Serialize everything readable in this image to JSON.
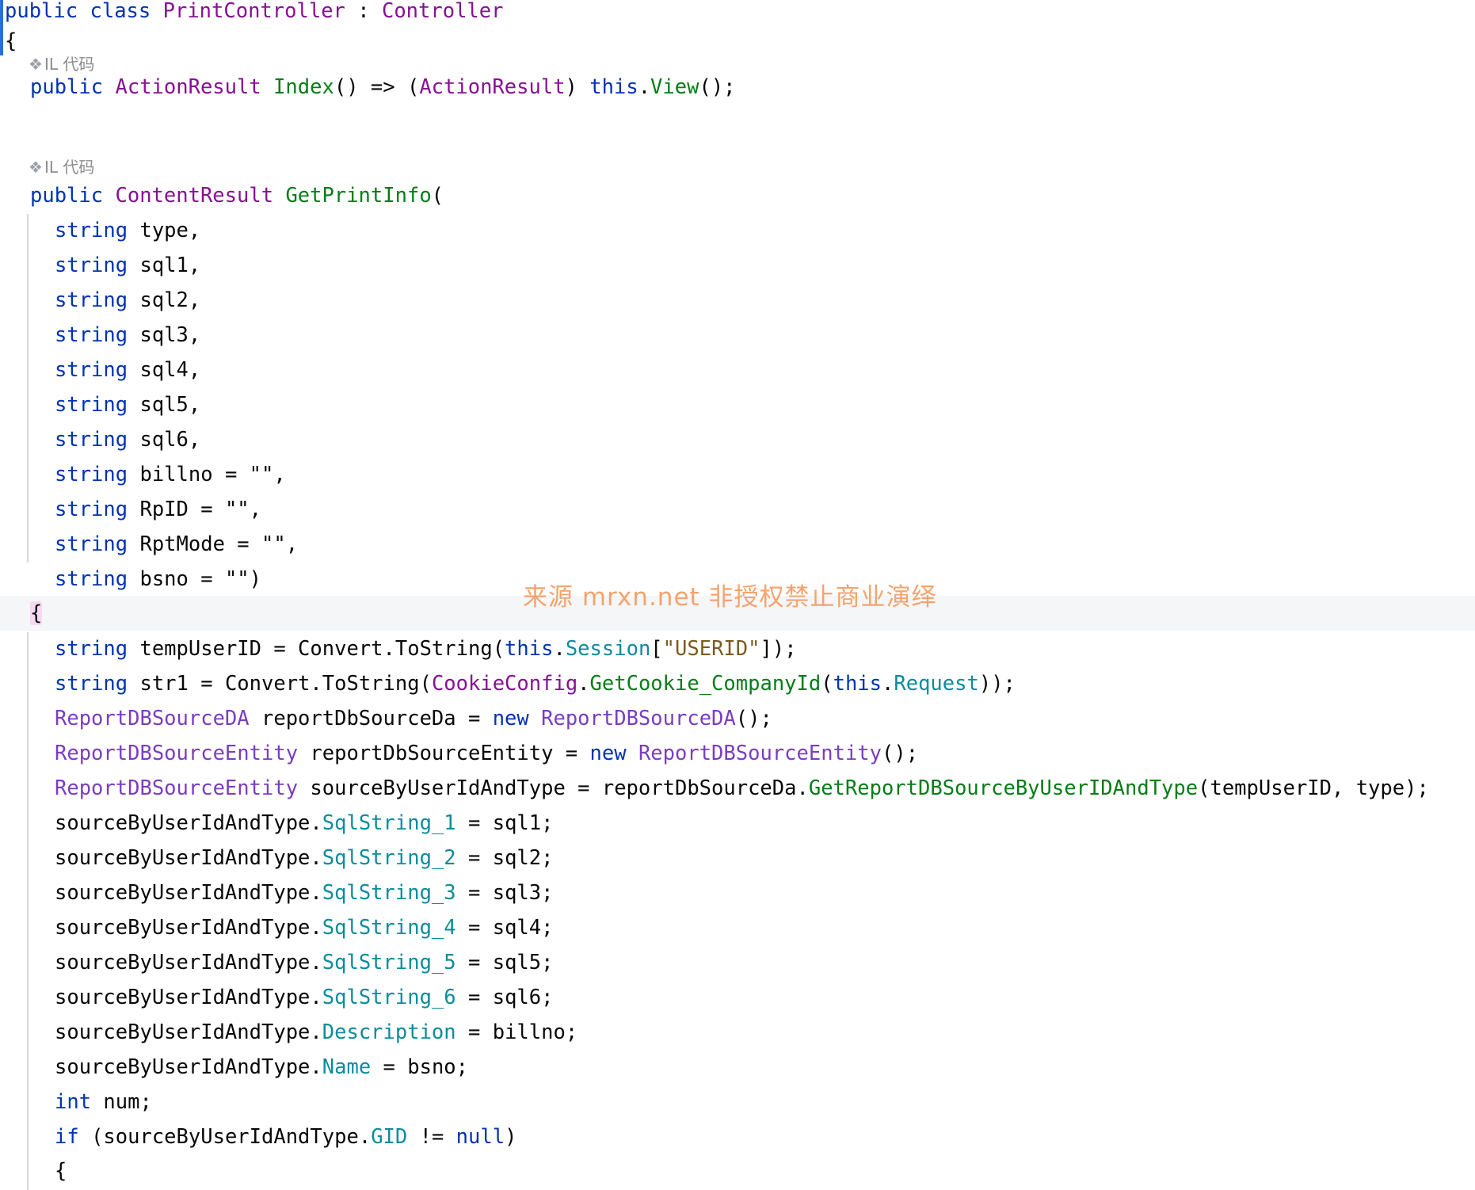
{
  "code": {
    "class_decl": {
      "kw_public": "public",
      "kw_class": "class",
      "class_name": "PrintController",
      "colon": " : ",
      "base": "Controller"
    },
    "open_brace": "{",
    "il_hint_1": "IL 代码",
    "index_line": {
      "kw_public": "public",
      "return_type": "ActionResult",
      "method": "Index",
      "rest1": "() => (",
      "cast_type": "ActionResult",
      "rest2": ") ",
      "kw_this": "this",
      "dot": ".",
      "call": "View",
      "rest3": "();"
    },
    "il_hint_2": "IL 代码",
    "getprint_line": {
      "kw_public": "public",
      "return_type": "ContentResult",
      "method": "GetPrintInfo",
      "paren": "("
    },
    "params": [
      {
        "kw": "string",
        "rest": " type,"
      },
      {
        "kw": "string",
        "rest": " sql1,"
      },
      {
        "kw": "string",
        "rest": " sql2,"
      },
      {
        "kw": "string",
        "rest": " sql3,"
      },
      {
        "kw": "string",
        "rest": " sql4,"
      },
      {
        "kw": "string",
        "rest": " sql5,"
      },
      {
        "kw": "string",
        "rest": " sql6,"
      },
      {
        "kw": "string",
        "rest": " billno = \"\","
      },
      {
        "kw": "string",
        "rest": " RpID = \"\","
      },
      {
        "kw": "string",
        "rest": " RptMode = \"\","
      },
      {
        "kw": "string",
        "rest": " bsno = \"\")"
      }
    ],
    "body_open": "{",
    "l_tempuser": {
      "kw": "string",
      "p1": " tempUserID = Convert.ToString(",
      "this": "this",
      "dot": ".",
      "field": "Session",
      "p2": "[",
      "str": "\"USERID\"",
      "p3": "]);"
    },
    "l_str1": {
      "kw": "string",
      "p1": " str1 = Convert.ToString(",
      "type": "CookieConfig",
      "dot": ".",
      "method": "GetCookie_CompanyId",
      "p2": "(",
      "this": "this",
      "dot2": ".",
      "field": "Request",
      "p3": "));"
    },
    "l_da": {
      "type": "ReportDBSourceDA",
      "p1": " reportDbSourceDa = ",
      "kw_new": "new",
      "sp": " ",
      "type2": "ReportDBSourceDA",
      "p2": "();"
    },
    "l_entity": {
      "type": "ReportDBSourceEntity",
      "p1": " reportDbSourceEntity = ",
      "kw_new": "new",
      "sp": " ",
      "type2": "ReportDBSourceEntity",
      "p2": "();"
    },
    "l_source": {
      "type": "ReportDBSourceEntity",
      "p1": " sourceByUserIdAndType = reportDbSourceDa.",
      "method": "GetReportDBSourceByUserIDAndType",
      "p2": "(tempUserID, type);"
    },
    "assigns": [
      {
        "obj": "sourceByUserIdAndType.",
        "field": "SqlString_1",
        "rest": " = sql1;"
      },
      {
        "obj": "sourceByUserIdAndType.",
        "field": "SqlString_2",
        "rest": " = sql2;"
      },
      {
        "obj": "sourceByUserIdAndType.",
        "field": "SqlString_3",
        "rest": " = sql3;"
      },
      {
        "obj": "sourceByUserIdAndType.",
        "field": "SqlString_4",
        "rest": " = sql4;"
      },
      {
        "obj": "sourceByUserIdAndType.",
        "field": "SqlString_5",
        "rest": " = sql5;"
      },
      {
        "obj": "sourceByUserIdAndType.",
        "field": "SqlString_6",
        "rest": " = sql6;"
      },
      {
        "obj": "sourceByUserIdAndType.",
        "field": "Description",
        "rest": " = billno;"
      },
      {
        "obj": "sourceByUserIdAndType.",
        "field": "Name",
        "rest": " = bsno;"
      }
    ],
    "l_int": {
      "kw": "int",
      "rest": " num;"
    },
    "l_if": {
      "kw": "if",
      "p1": " (sourceByUserIdAndType.",
      "field": "GID",
      "p2": " != ",
      "kw_null": "null",
      "p3": ")"
    },
    "if_open": "{"
  },
  "watermark": "来源 mrxn.net 非授权禁止商业演绎",
  "colors": {
    "keyword": "#0033b3",
    "type": "#871094",
    "method": "#00627a",
    "field": "#0c8c9c",
    "string": "#7a5c1e",
    "watermark": "#f4a36e"
  },
  "icons": {
    "il_hint": "diamond-icon"
  }
}
